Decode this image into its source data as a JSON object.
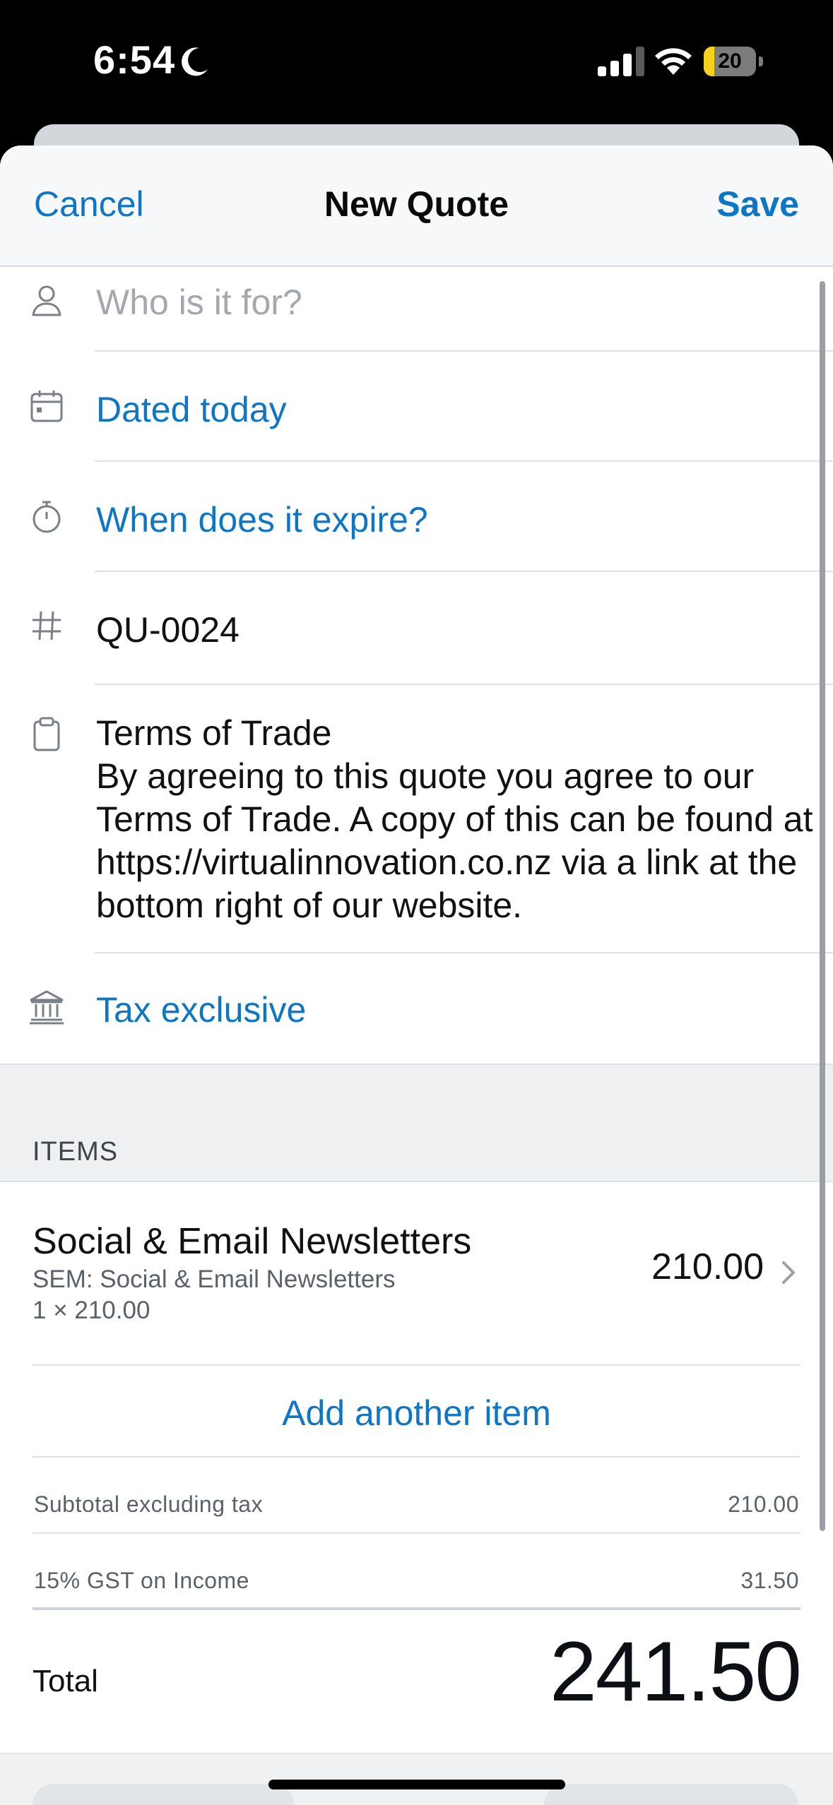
{
  "status_bar": {
    "time": "6:54",
    "battery_percent": 20,
    "battery_label": "20",
    "icons": [
      "moon-icon",
      "cellular-signal-icon",
      "wifi-icon",
      "battery-icon"
    ]
  },
  "nav": {
    "cancel_label": "Cancel",
    "title": "New Quote",
    "save_label": "Save"
  },
  "form": {
    "contact_placeholder": "Who is it for?",
    "date_label": "Dated today",
    "expiry_label": "When does it expire?",
    "quote_number": "QU-0024",
    "terms_title": "Terms of Trade",
    "terms_body": "By agreeing to this quote you agree to our Terms of Trade. A copy of this can be found at https://virtualinnovation.co.nz via a link at the bottom right of our website.",
    "tax_label": "Tax exclusive"
  },
  "items_section": {
    "header": "ITEMS",
    "items": [
      {
        "name": "Social & Email Newsletters",
        "code_description": "SEM: Social & Email Newsletters",
        "quantity_line": "1 × 210.00",
        "amount": "210.00"
      }
    ],
    "add_item_label": "Add another item"
  },
  "summary": {
    "subtotal_label": "Subtotal excluding tax",
    "subtotal_value": "210.00",
    "tax_label": "15% GST on Income",
    "tax_value": "31.50",
    "total_label": "Total",
    "total_value": "241.50"
  },
  "colors": {
    "accent": "#0f76c5",
    "text_primary": "#111111",
    "text_secondary": "#5b6168",
    "placeholder": "#a3a8ae",
    "battery_fill": "#f5d21c"
  }
}
